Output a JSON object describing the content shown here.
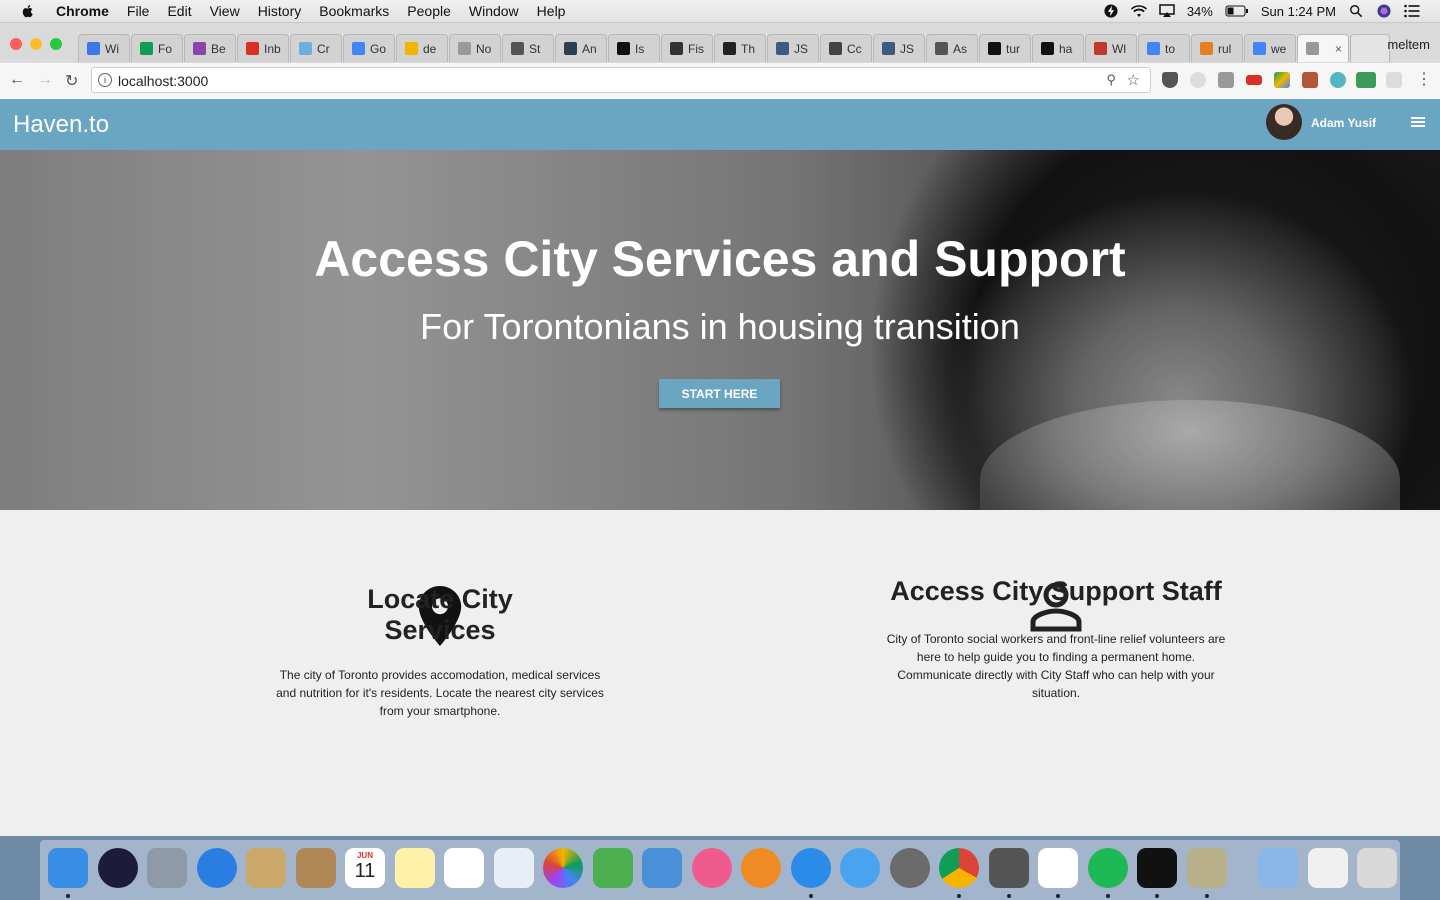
{
  "menubar": {
    "app_name": "Chrome",
    "items": [
      "File",
      "Edit",
      "View",
      "History",
      "Bookmarks",
      "People",
      "Window",
      "Help"
    ],
    "battery": "34%",
    "clock": "Sun 1:24 PM"
  },
  "browser": {
    "tabs": [
      {
        "label": "Wi",
        "color": "#3b78e7",
        "icon": "docs-icon"
      },
      {
        "label": "Fo",
        "color": "#0f9d58",
        "icon": "sheets-icon"
      },
      {
        "label": "Be",
        "color": "#8e44ad",
        "icon": "behance-icon"
      },
      {
        "label": "Inb",
        "color": "#d93025",
        "icon": "gmail-icon"
      },
      {
        "label": "Cr",
        "color": "#6ab0de",
        "icon": "cloud-icon"
      },
      {
        "label": "Go",
        "color": "#4285f4",
        "icon": "translate-icon"
      },
      {
        "label": "de",
        "color": "#f4b400",
        "icon": "drive-icon"
      },
      {
        "label": "No",
        "color": "#999999",
        "icon": "page-icon"
      },
      {
        "label": "St",
        "color": "#555555",
        "icon": "peace-icon"
      },
      {
        "label": "An",
        "color": "#2c3e50",
        "icon": "face-icon"
      },
      {
        "label": "Is",
        "color": "#111111",
        "icon": "nyt-icon"
      },
      {
        "label": "Fis",
        "color": "#333333",
        "icon": "wikipedia-icon"
      },
      {
        "label": "Th",
        "color": "#222222",
        "icon": "avatar-icon"
      },
      {
        "label": "JS",
        "color": "#3d5a80",
        "icon": "js-icon"
      },
      {
        "label": "Cc",
        "color": "#444444",
        "icon": "circle-plus-icon"
      },
      {
        "label": "JS",
        "color": "#3d5a80",
        "icon": "js-icon"
      },
      {
        "label": "As",
        "color": "#555555",
        "icon": "braces-icon"
      },
      {
        "label": "tur",
        "color": "#111111",
        "icon": "github-icon"
      },
      {
        "label": "ha",
        "color": "#111111",
        "icon": "github-icon"
      },
      {
        "label": "Wl",
        "color": "#c0392b",
        "icon": "medium-icon"
      },
      {
        "label": "to",
        "color": "#4285f4",
        "icon": "google-icon"
      },
      {
        "label": "rul",
        "color": "#e67e22",
        "icon": "hand-icon"
      },
      {
        "label": "we",
        "color": "#4285f4",
        "icon": "google-icon"
      },
      {
        "label": "",
        "color": "#999999",
        "icon": "page-icon"
      }
    ],
    "profile": "meltem",
    "url": "localhost:3000"
  },
  "site": {
    "brand": "Haven.to",
    "user_name": "Adam Yusif",
    "hero": {
      "title": "Access City Services and Support",
      "subtitle": "For Torontonians in housing transition",
      "cta": "START HERE"
    },
    "features": [
      {
        "title": "Locate City Services",
        "body": "The city of Toronto provides accomodation, medical services and nutrition for it's residents. Locate the nearest city services from your smartphone.",
        "icon": "map-pin-icon"
      },
      {
        "title": "Access City Support Staff",
        "body": "City of Toronto social workers and front-line relief volunteers are here to help guide you to finding a permanent home. Communicate directly with City Staff who can help with your situation.",
        "icon": "person-icon"
      }
    ],
    "colors": {
      "navbar": "#6aa6c2",
      "button": "#6aa6c2"
    }
  },
  "dock": {
    "apps": [
      "finder-icon",
      "siri-icon",
      "launchpad-icon",
      "safari-icon",
      "mail-icon",
      "contacts-icon",
      "calendar-icon",
      "notes-icon",
      "reminders-icon",
      "preview-icon",
      "photos-icon",
      "numbers-icon",
      "keynote-icon",
      "itunes-icon",
      "ibooks-icon",
      "app-store-icon",
      "messages-icon",
      "system-preferences-icon",
      "chrome-icon",
      "sublime-icon",
      "slack-icon",
      "spotify-icon",
      "terminal-icon",
      "archive-icon",
      "applications-folder-icon",
      "zip-file-icon",
      "trash-icon"
    ],
    "calendar": {
      "month": "JUN",
      "day": "11"
    }
  }
}
